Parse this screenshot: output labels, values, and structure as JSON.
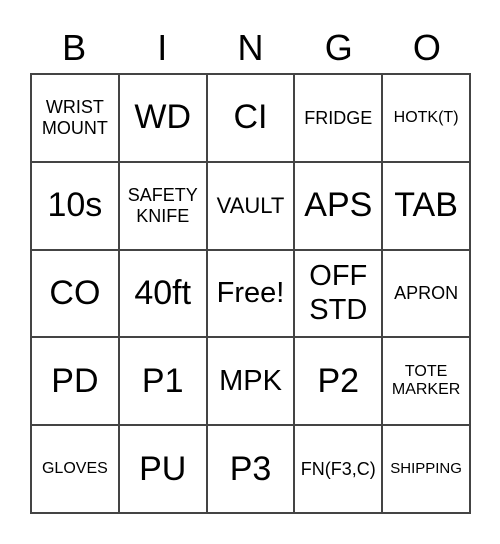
{
  "header": [
    "B",
    "I",
    "N",
    "G",
    "O"
  ],
  "cells": [
    [
      "WRIST\nMOUNT",
      "WD",
      "CI",
      "FRIDGE",
      "HOTK(T)"
    ],
    [
      "10s",
      "SAFETY\nKNIFE",
      "VAULT",
      "APS",
      "TAB"
    ],
    [
      "CO",
      "40ft",
      "Free!",
      "OFF\nSTD",
      "APRON"
    ],
    [
      "PD",
      "P1",
      "MPK",
      "P2",
      "TOTE\nMARKER"
    ],
    [
      "GLOVES",
      "PU",
      "P3",
      "FN(F3,C)",
      "SHIPPING"
    ]
  ]
}
